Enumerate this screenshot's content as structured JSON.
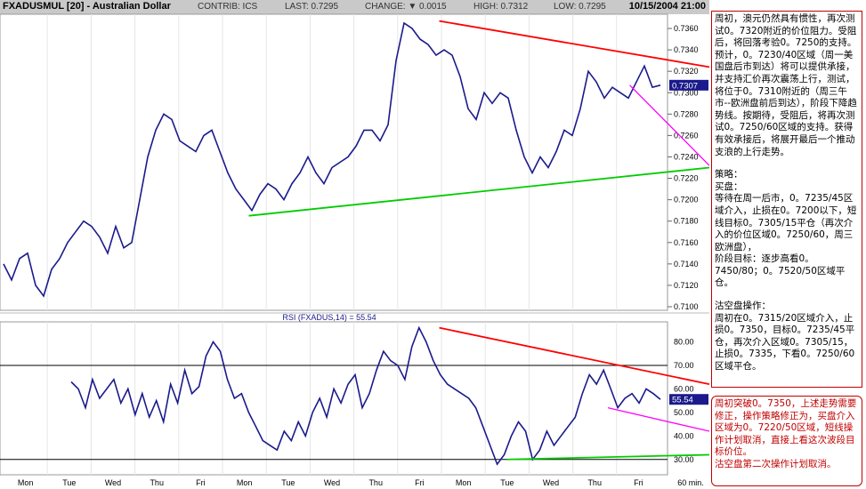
{
  "header": {
    "symbol": "FXADUSMUL [20] - Australian Dollar",
    "contrib": "CONTRIB: ICS",
    "last": "LAST: 0.7295",
    "change": "CHANGE: ▼ 0.0015",
    "high": "HIGH: 0.7312",
    "low": "LOW: 0.7295",
    "datetime": "10/15/2004 21:00"
  },
  "colors": {
    "price": "#1a1a8c",
    "rsi": "#1a1a8c",
    "resistance": "#ff0000",
    "support": "#00cc00",
    "projection": "#ff00ff",
    "header_bg": "#c9c9c9"
  },
  "chart_data": [
    {
      "type": "line",
      "title": "",
      "x": [
        "Mon",
        "Tue",
        "Wed",
        "Thu",
        "Fri",
        "Mon",
        "Tue",
        "Wed",
        "Thu",
        "Fri",
        "Mon",
        "Tue",
        "Wed",
        "Thu",
        "Fri"
      ],
      "ylim": [
        0.71,
        0.737
      ],
      "yticks": [
        "0.7360",
        "0.7340",
        "0.7320",
        "0.7300",
        "0.7280",
        "0.7260",
        "0.7240",
        "0.7220",
        "0.7200",
        "0.7180",
        "0.7160",
        "0.7140",
        "0.7120",
        "0.7100"
      ],
      "last_value_label": "0.7307",
      "series": [
        {
          "values": [
            0.714,
            0.7125,
            0.7145,
            0.715,
            0.712,
            0.711,
            0.7135,
            0.7145,
            0.716,
            0.717,
            0.718,
            0.7175,
            0.7165,
            0.715,
            0.7175,
            0.7155,
            0.716,
            0.72,
            0.724,
            0.7265,
            0.728,
            0.7275,
            0.7255,
            0.725,
            0.7245,
            0.726,
            0.7265,
            0.7245,
            0.7225,
            0.721,
            0.72,
            0.719,
            0.7205,
            0.7215,
            0.721,
            0.72,
            0.7215,
            0.7225,
            0.724,
            0.7225,
            0.7215,
            0.723,
            0.7235,
            0.724,
            0.725,
            0.7265,
            0.7265,
            0.7255,
            0.727,
            0.733,
            0.7365,
            0.736,
            0.735,
            0.7345,
            0.7335,
            0.734,
            0.7335,
            0.7315,
            0.7285,
            0.7275,
            0.73,
            0.729,
            0.73,
            0.7295,
            0.7265,
            0.724,
            0.7225,
            0.724,
            0.723,
            0.7245,
            0.7265,
            0.726,
            0.7285,
            0.732,
            0.731,
            0.7295,
            0.7305,
            0.73,
            0.7295,
            0.731,
            0.7325,
            0.7305,
            0.7307
          ]
        }
      ],
      "annotations": [
        {
          "kind": "resistance",
          "points": [
            [
              "Fri",
              0.7367
            ],
            [
              "end",
              0.7324
            ]
          ]
        },
        {
          "kind": "support",
          "points": [
            [
              "Mon",
              0.7185
            ],
            [
              "end",
              0.723
            ]
          ]
        },
        {
          "kind": "projection",
          "points": [
            [
              "Fri",
              0.7307
            ],
            [
              "end",
              0.7232
            ]
          ]
        }
      ]
    },
    {
      "type": "line",
      "title": "RSI (FXADUS,14) = 55.54",
      "ylim": [
        25,
        87
      ],
      "yticks": [
        "80.00",
        "70.00",
        "60.00",
        "50.00",
        "40.00",
        "30.00"
      ],
      "reference_lines": [
        70,
        30
      ],
      "last_value_label": "55.54",
      "series": [
        {
          "values": [
            63,
            60,
            52,
            64,
            56,
            60,
            64,
            54,
            60,
            49,
            58,
            48,
            55,
            46,
            62,
            54,
            68,
            58,
            61,
            74,
            80,
            76,
            64,
            56,
            58,
            50,
            44,
            38,
            36,
            34,
            42,
            38,
            46,
            40,
            50,
            56,
            48,
            60,
            54,
            62,
            66,
            52,
            58,
            68,
            76,
            72,
            70,
            64,
            78,
            86,
            80,
            72,
            66,
            62,
            60,
            58,
            56,
            52,
            44,
            36,
            28,
            32,
            40,
            46,
            42,
            30,
            34,
            42,
            36,
            40,
            44,
            48,
            58,
            66,
            62,
            68,
            60,
            52,
            56,
            58,
            54,
            60,
            58,
            55.54
          ]
        }
      ],
      "annotations": [
        {
          "kind": "resistance",
          "points": [
            [
              "Fri",
              86
            ],
            [
              "end",
              62
            ]
          ]
        },
        {
          "kind": "support",
          "points": [
            [
              "Tue",
              30
            ],
            [
              "end",
              32
            ]
          ]
        },
        {
          "kind": "projection",
          "points": [
            [
              "Fri",
              52
            ],
            [
              "end",
              42
            ]
          ]
        }
      ],
      "x_footer": "60 min."
    }
  ],
  "panel_top": [
    "周初，澳元仍然具有惯性，再次测试0。7320附近的价位阻力。受阻后，将回落考验0。7250的支持。预计，0。7230/40区域（周一美国盘后市到达）将可以提供承接，并支持汇价再次震荡上行，测试，将位于0。7310附近的（周三午市--欧洲盘前后到达），阶段下降趋势线。按期待，受阻后，将再次测试0。7250/60区域的支持。获得有效承接后，将展开最后一个推动支浪的上行走势。",
    "",
    "策略：",
    "买盘：",
    "等待在周一后市，0。7235/45区域介入，止损在0。7200以下，短线目标0。7305/15平仓（再次介入的价位区域0。7250/60，周三欧洲盘），",
    "阶段目标：逐步高看0。7450/80；0。7520/50区域平仓。",
    "",
    "沽空盘操作：",
    "周初在0。7315/20区域介入，止损0。7350，目标0。7235/45平仓，再次介入区域0。7305/15，止损0。7335，下看0。7250/60区域平仓。"
  ],
  "panel_bottom": [
    "周初突破0。7350，上述走势需要修正，操作策略修正为，买盘介入区域为0。7220/50区域，短线操作计划取消，直接上看这次波段目标价位。",
    "沽空盘第二次操作计划取消。"
  ]
}
